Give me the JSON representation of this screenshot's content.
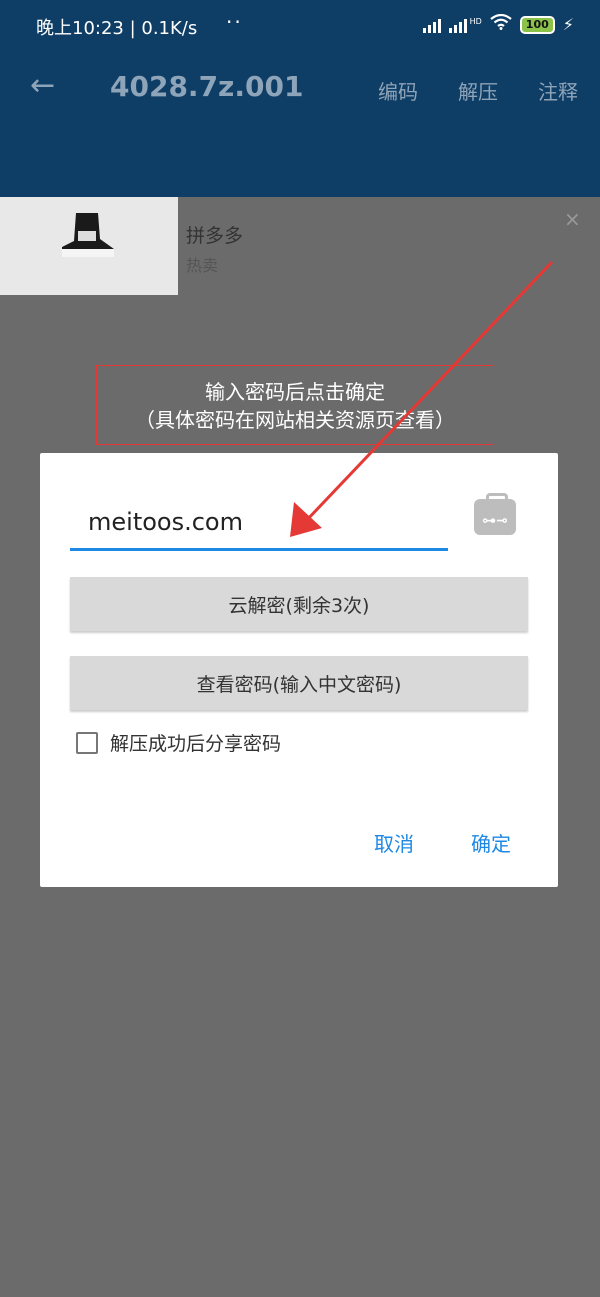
{
  "status_bar": {
    "time_speed": "晚上10:23 | 0.1K/s",
    "dots": "··",
    "network_label": "HD",
    "battery": "100"
  },
  "app_bar": {
    "title": "4028.7z.001",
    "menu": [
      "编码",
      "解压",
      "注释"
    ]
  },
  "ad": {
    "title": "拼多多",
    "subtitle": "热卖",
    "close": "×"
  },
  "annotation": {
    "line1": "输入密码后点击确定",
    "line2": "（具体密码在网站相关资源页查看）"
  },
  "dialog": {
    "password_value": "meitoos.com",
    "cloud_decrypt_label": "云解密(剩余3次)",
    "view_password_label": "查看密码(输入中文密码)",
    "share_checkbox_label": "解压成功后分享密码",
    "share_checked": false,
    "cancel_label": "取消",
    "confirm_label": "确定"
  },
  "colors": {
    "app_bar": "#0e3d66",
    "accent": "#1e88e5",
    "annotation": "#e53935",
    "overlay": "#6b6b6b"
  }
}
